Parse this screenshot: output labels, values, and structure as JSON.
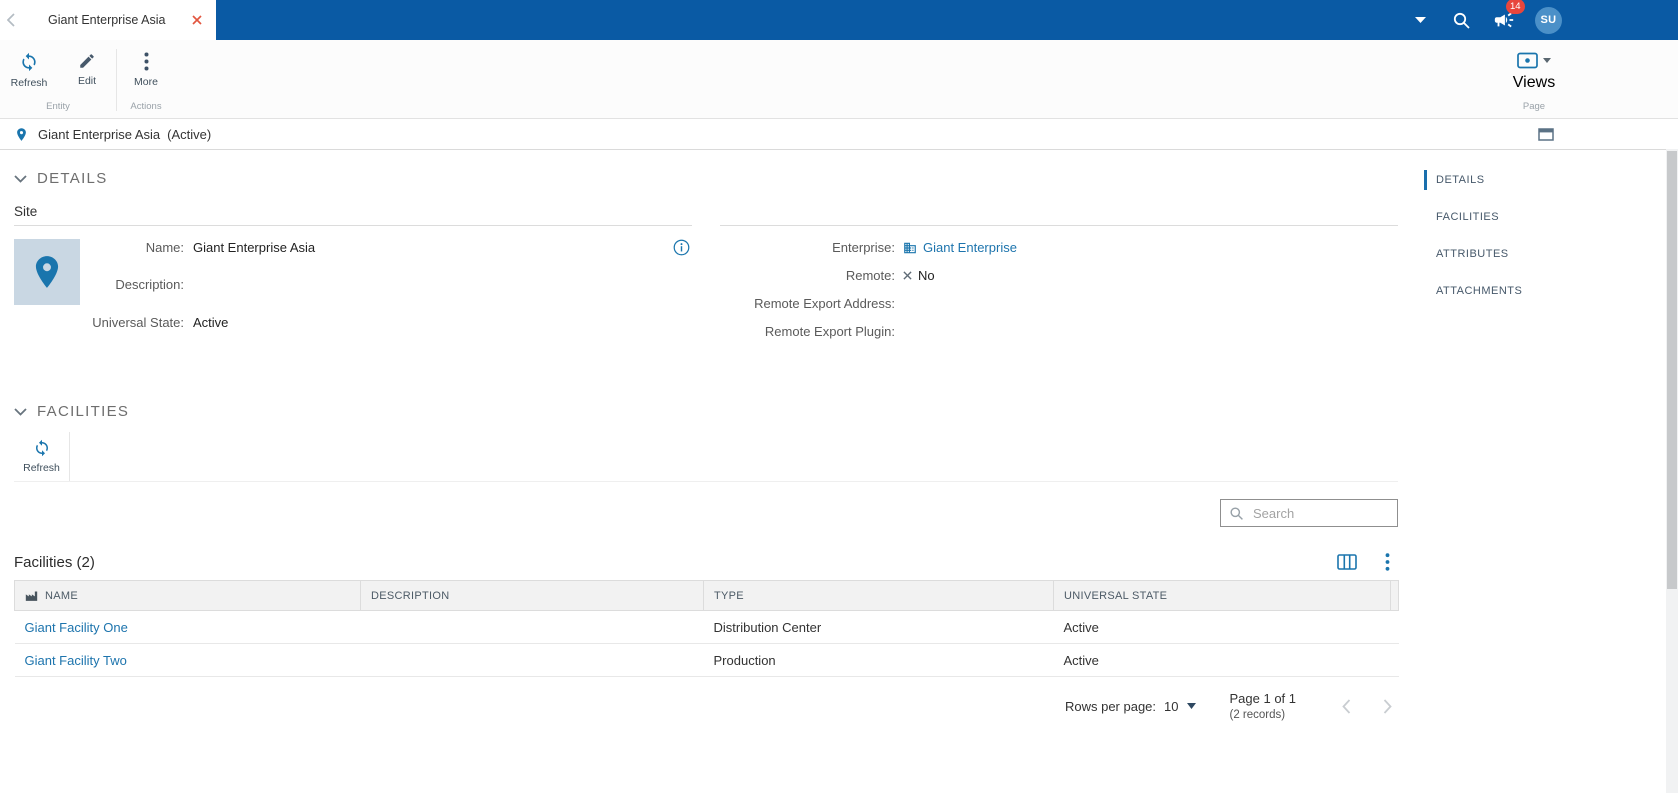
{
  "topbar": {
    "tab_title": "Giant Enterprise Asia",
    "notification_count": "14",
    "avatar_initials": "SU"
  },
  "toolbar": {
    "refresh": "Refresh",
    "edit": "Edit",
    "more": "More",
    "group_entity": "Entity",
    "group_actions": "Actions",
    "views": "Views",
    "group_page": "Page"
  },
  "entity_header": {
    "title": "Giant Enterprise Asia",
    "status": "(Active)"
  },
  "side_nav": {
    "items": [
      {
        "label": "DETAILS"
      },
      {
        "label": "FACILITIES"
      },
      {
        "label": "ATTRIBUTES"
      },
      {
        "label": "ATTACHMENTS"
      }
    ]
  },
  "details": {
    "title": "DETAILS",
    "subsection": "Site",
    "name_label": "Name:",
    "name_value": "Giant Enterprise Asia",
    "description_label": "Description:",
    "description_value": "",
    "universal_state_label": "Universal State:",
    "universal_state_value": "Active",
    "enterprise_label": "Enterprise:",
    "enterprise_value": "Giant Enterprise",
    "remote_label": "Remote:",
    "remote_value": "No",
    "remote_export_address_label": "Remote Export Address:",
    "remote_export_address_value": "",
    "remote_export_plugin_label": "Remote Export Plugin:",
    "remote_export_plugin_value": ""
  },
  "facilities": {
    "title": "FACILITIES",
    "refresh": "Refresh",
    "search_placeholder": "Search",
    "list_title": "Facilities (2)",
    "columns": {
      "name": "NAME",
      "description": "DESCRIPTION",
      "type": "TYPE",
      "universal_state": "UNIVERSAL STATE"
    },
    "rows": [
      {
        "name": "Giant Facility One",
        "description": "",
        "type": "Distribution Center",
        "universal_state": "Active"
      },
      {
        "name": "Giant Facility Two",
        "description": "",
        "type": "Production",
        "universal_state": "Active"
      }
    ],
    "pagination": {
      "rows_per_page_label": "Rows per page:",
      "rows_per_page_value": "10",
      "page_label": "Page 1 of 1",
      "records_label": "(2 records)"
    }
  },
  "colors": {
    "topbar_blue": "#0a5aa4",
    "accent_blue": "#1a75ad",
    "link_blue": "#1d74ad",
    "badge_red": "#e8463c"
  },
  "icons": {
    "back": "chevron-left",
    "tab_close": "x-mark",
    "topbar_dropdown": "caret-down",
    "search": "magnifier",
    "notifications": "megaphone",
    "refresh": "sync-arrows",
    "edit": "pencil",
    "more": "vertical-dots",
    "views": "eye-panel",
    "entity": "location-pin",
    "open_window": "popup-window",
    "info": "circle-i",
    "enterprise": "building",
    "remote_no": "x-mark",
    "name_column": "facility",
    "column_chooser": "table-columns",
    "grid_menu": "vertical-dots"
  }
}
